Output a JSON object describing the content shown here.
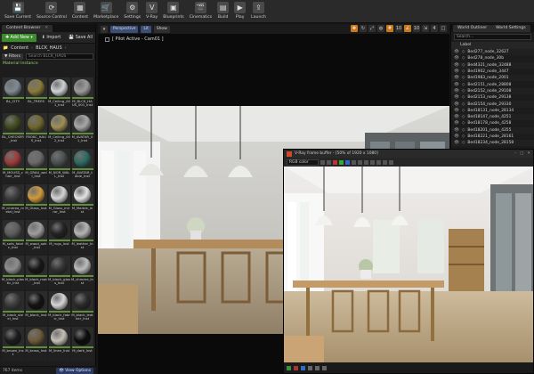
{
  "toolbar": {
    "buttons": [
      {
        "label": "Save Current",
        "icon": "save-icon",
        "glyph": "💾"
      },
      {
        "label": "Source Control",
        "icon": "source-control-icon",
        "glyph": "⟳"
      },
      {
        "label": "Content",
        "icon": "content-icon",
        "glyph": "▦"
      },
      {
        "label": "Marketplace",
        "icon": "marketplace-icon",
        "glyph": "🛒"
      },
      {
        "label": "Settings",
        "icon": "gear-icon",
        "glyph": "⚙"
      },
      {
        "label": "V-Ray",
        "icon": "vray-icon",
        "glyph": "V"
      },
      {
        "label": "Blueprints",
        "icon": "blueprint-icon",
        "glyph": "▣"
      },
      {
        "label": "Cinematics",
        "icon": "cinematics-icon",
        "glyph": "🎬"
      },
      {
        "label": "Build",
        "icon": "build-icon",
        "glyph": "▤"
      },
      {
        "label": "Play",
        "icon": "play-icon",
        "glyph": "▶"
      },
      {
        "label": "Launch",
        "icon": "launch-icon",
        "glyph": "⇪"
      }
    ]
  },
  "content_browser": {
    "tab_label": "Content Browser",
    "add_new": "Add New",
    "import": "Import",
    "save_all": "Save All",
    "path": [
      "Content",
      "BLCK_HAUS"
    ],
    "filters": "Filters",
    "search_placeholder": "Search BLCK_HAUS",
    "filter_tag": "Material Instance",
    "assets": [
      {
        "label": "BL_CITY",
        "color": "#7f8b94"
      },
      {
        "label": "BL_TREES",
        "color": "#8a7a3a"
      },
      {
        "label": "M_Ceiling_001_Inst",
        "color": "#cfd3d6"
      },
      {
        "label": "M_BLCK_HAUS_001_Inst",
        "color": "#9b9b9b"
      },
      {
        "label": "BL_CHECKER_Inst",
        "color": "#3f4a1e"
      },
      {
        "label": "FBOKC_HAUS_Inst",
        "color": "#70672c"
      },
      {
        "label": "M_Ceiling_002_Inst",
        "color": "#9f8e55"
      },
      {
        "label": "M_AVATAR_01_Inst",
        "color": "#a7a7a7"
      },
      {
        "label": "M_MOUSS_chair_Inst",
        "color": "#9b3a3a"
      },
      {
        "label": "M_GRAU_wall_Inst",
        "color": "#6a6a6a"
      },
      {
        "label": "M_NOR_WALL_Inst",
        "color": "#4b5051"
      },
      {
        "label": "M_AVATAR_table_Inst",
        "color": "#2c6a62"
      },
      {
        "label": "M_cinerea_metal_Inst",
        "color": "#3d3d3d"
      },
      {
        "label": "M_Glass_Inst",
        "color": "#d09a3a"
      },
      {
        "label": "M_Glass_mirror_Inst",
        "color": "#d4d4d4"
      },
      {
        "label": "M_Marble_Inst",
        "color": "#e4e4e4"
      },
      {
        "label": "M_sofa_fabric_Inst",
        "color": "#5c5c5c"
      },
      {
        "label": "M_wood_oak_Inst",
        "color": "#9e9e9e"
      },
      {
        "label": "M_rugs_Inst",
        "color": "#222222"
      },
      {
        "label": "M_leather_Inst",
        "color": "#b5b5b5"
      },
      {
        "label": "M_black_plastic_Inst",
        "color": "#8e8e8e"
      },
      {
        "label": "M_black_mat_Inst",
        "color": "#171717"
      },
      {
        "label": "M_black_gloss_Inst",
        "color": "#333333"
      },
      {
        "label": "M_chrome_Inst",
        "color": "#bcbcbc"
      },
      {
        "label": "M_black_steel_Inst",
        "color": "#3b3b3b"
      },
      {
        "label": "M_block_Inst",
        "color": "#121212"
      },
      {
        "label": "M_black_fabric_Inst",
        "color": "#d6d6d6"
      },
      {
        "label": "M_black_leather_Inst",
        "color": "#2a2a2a"
      },
      {
        "label": "M_brown_Inst",
        "color": "#1b1b1b"
      },
      {
        "label": "M_brass_Inst",
        "color": "#6e5a3a"
      },
      {
        "label": "M_linen_Inst",
        "color": "#c5c0b5"
      },
      {
        "label": "M_dark_Inst",
        "color": "#0c0c0c"
      }
    ],
    "status_items": "767 items",
    "view_options": "View Options"
  },
  "viewport": {
    "perspective": "Perspective",
    "lit": "Lit",
    "show": "Show",
    "pilot_label": "[ Pilot Active - Cam01 ]"
  },
  "frame_buffer": {
    "title": "V-Ray frame buffer - [50% of 1920 x 1080]",
    "channel": "RGB color"
  },
  "outliner": {
    "tab_label": "World Outliner",
    "tab2_label": "World Settings",
    "search_placeholder": "Search...",
    "column": "Label",
    "rows": [
      "Bed277_node_32627",
      "Bed278_node_30b",
      "Bed4321_node_32488",
      "Bed1902_node_3447",
      "Bed1983_node_2001",
      "Bed2151_node_28808",
      "Bed2152_node_29108",
      "Bed2153_node_29138",
      "Bed2154_node_29330",
      "Bed18131_node_28134",
      "Bed18147_node_4251",
      "Bed18178_node_4258",
      "Bed18201_node_4355",
      "Bed18221_node_28161",
      "Bed18234_node_28158"
    ]
  },
  "colors": {
    "accent_green": "#3c8c2c",
    "accent_orange": "#c7771d",
    "accent_blue": "#2c3b66"
  }
}
